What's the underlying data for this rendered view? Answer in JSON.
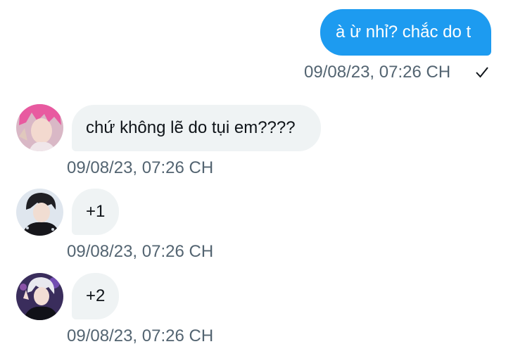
{
  "messages": [
    {
      "direction": "outgoing",
      "text": "à ừ nhỉ? chắc do t",
      "timestamp": "09/08/23, 07:26 CH",
      "status_icon": "checkmark-icon"
    },
    {
      "direction": "incoming",
      "avatar_icon": "pink-hair-avatar",
      "text": "chứ không lẽ do tụi em????",
      "timestamp": "09/08/23, 07:26 CH"
    },
    {
      "direction": "incoming",
      "avatar_icon": "dark-hair-avatar",
      "text": "+1",
      "timestamp": "09/08/23, 07:26 CH"
    },
    {
      "direction": "incoming",
      "avatar_icon": "white-hair-avatar",
      "text": "+2",
      "timestamp": "09/08/23, 07:26 CH"
    }
  ],
  "colors": {
    "outgoing_bubble": "#1d9bf0",
    "incoming_bubble": "#eff3f4",
    "timestamp_text": "#536471",
    "message_text": "#0f1419"
  }
}
